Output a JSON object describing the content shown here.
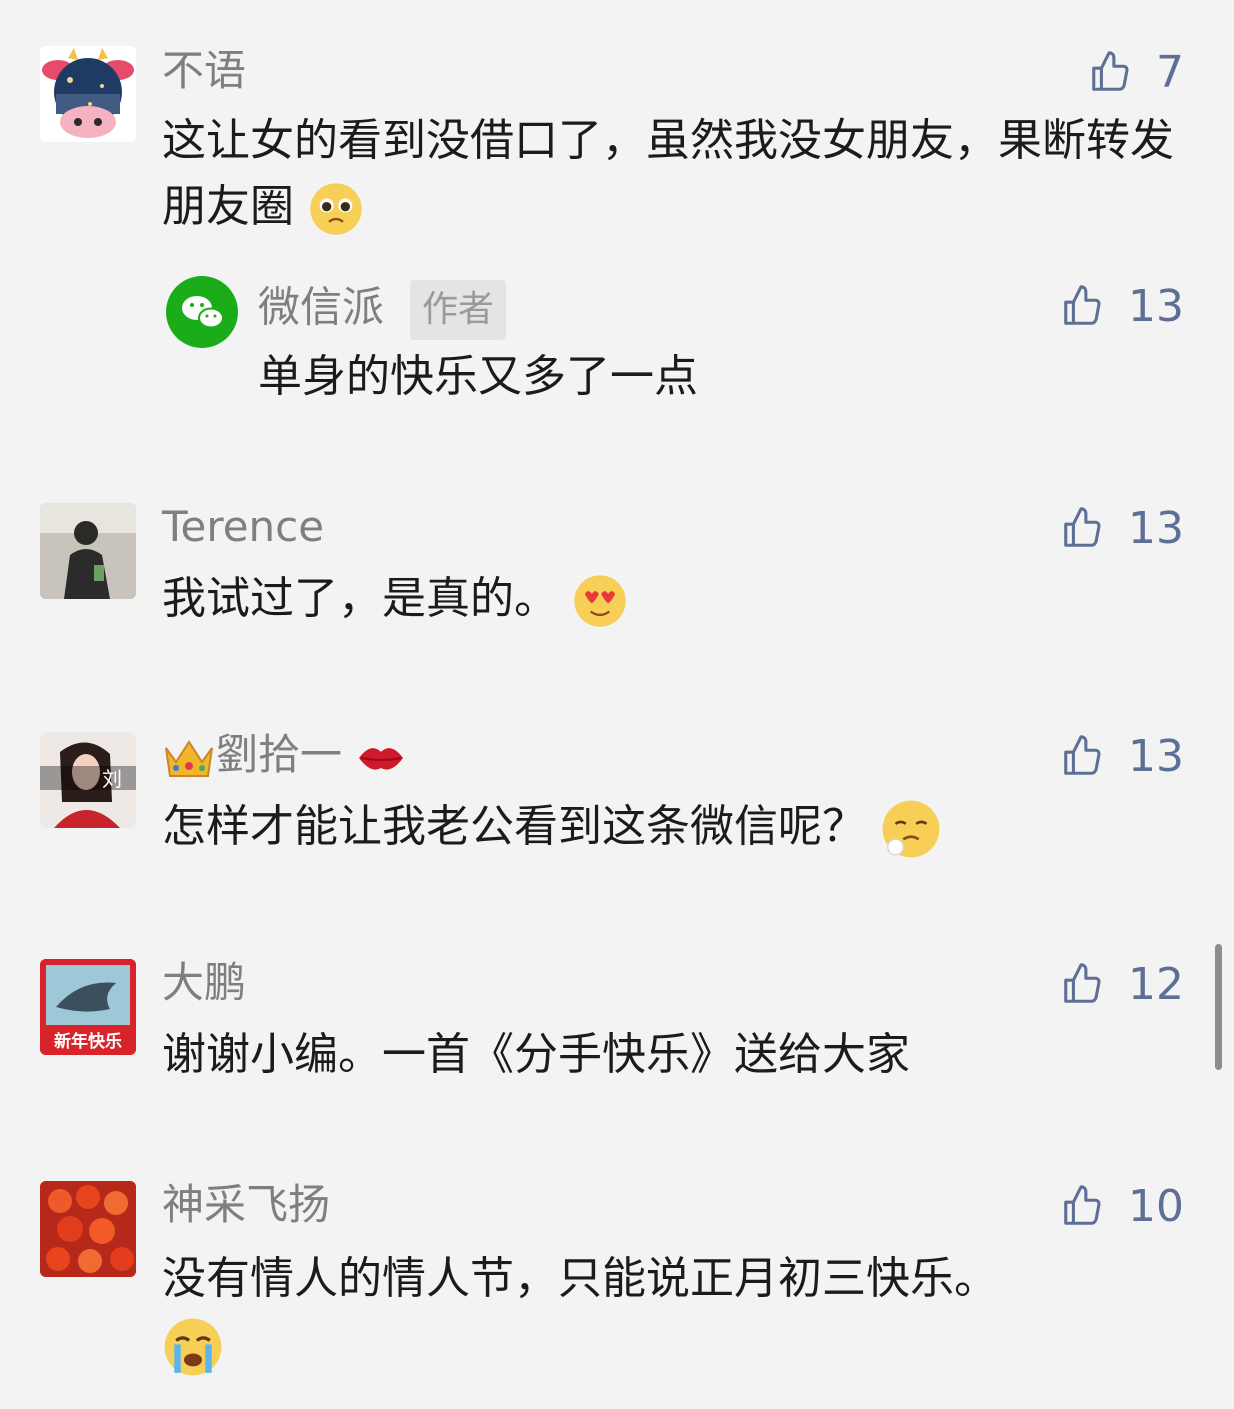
{
  "comments": [
    {
      "name": "不语",
      "likes": "7",
      "text": "这让女的看到没借口了，虽然我没女朋友，果断转发朋友圈",
      "emoji": "pleading-face",
      "reply": {
        "name": "微信派",
        "tag": "作者",
        "likes": "13",
        "text": "单身的快乐又多了一点"
      }
    },
    {
      "name": "Terence",
      "likes": "13",
      "text": "我试过了，是真的。",
      "emoji": "heart-eyes-face"
    },
    {
      "name": "劉拾一",
      "likes": "13",
      "text": "怎样才能让我老公看到这条微信呢？",
      "emoji": "crying-snot-face",
      "name_prefix_icon": "crown",
      "name_suffix_icon": "lips"
    },
    {
      "name": "大鹏",
      "likes": "12",
      "text": "谢谢小编。一首《分手快乐》送给大家",
      "avatar_text": "新年快乐"
    },
    {
      "name": "神采飞扬",
      "likes": "10",
      "text": "没有情人的情人节，只能说正月初三快乐。",
      "emoji": "sobbing-face"
    }
  ],
  "avatar_labels": {
    "liu": "刘"
  },
  "colors": {
    "background": "#f3f3f3",
    "name": "#7f7f7f",
    "like": "#5d6f94",
    "wechat_green": "#1aad19"
  }
}
